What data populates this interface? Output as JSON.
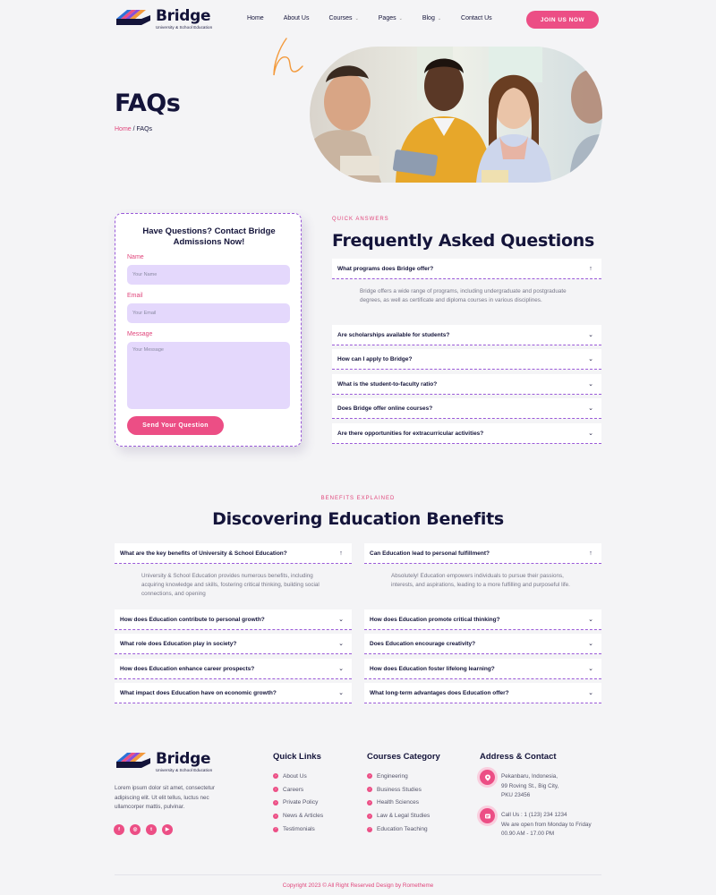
{
  "brand": {
    "name": "Bridge",
    "tagline": "University & School Education",
    "colors": {
      "accent": "#ec4e85",
      "navy": "#14143a",
      "lavender": "#e4d8fc",
      "border": "#9a5ad8"
    }
  },
  "nav": {
    "items": [
      {
        "label": "Home",
        "has_dropdown": false
      },
      {
        "label": "About Us",
        "has_dropdown": false
      },
      {
        "label": "Courses",
        "has_dropdown": true
      },
      {
        "label": "Pages",
        "has_dropdown": true
      },
      {
        "label": "Blog",
        "has_dropdown": true
      },
      {
        "label": "Contact Us",
        "has_dropdown": false
      }
    ],
    "cta": "JOIN US NOW"
  },
  "hero": {
    "title": "FAQs",
    "breadcrumb": {
      "home": "Home",
      "separator": " / ",
      "current": "FAQs"
    }
  },
  "contact_form": {
    "title": "Have Questions? Contact Bridge Admissions Now!",
    "name_label": "Name",
    "name_placeholder": "Your Name",
    "email_label": "Email",
    "email_placeholder": "Your Email",
    "message_label": "Message",
    "message_placeholder": "Your Message",
    "submit": "Send Your Question"
  },
  "faq": {
    "eyebrow": "QUICK ANSWERS",
    "title": "Frequently Asked Questions",
    "open": {
      "question": "What programs does Bridge offer?",
      "answer": "Bridge offers a wide range of programs, including undergraduate and postgraduate degrees, as well as certificate and diploma courses in various disciplines."
    },
    "items": [
      "Are scholarships available for students?",
      "How can I apply to Bridge?",
      "What is the student-to-faculty ratio?",
      "Does Bridge offer online courses?",
      "Are there opportunities for extracurricular activities?"
    ]
  },
  "benefits": {
    "eyebrow": "BENEFITS EXPLAINED",
    "title": "Discovering Education Benefits",
    "left_open": {
      "question": "What are the key benefits of University & School Education?",
      "answer": "University & School Education provides numerous benefits, including acquiring knowledge and skills, fostering critical thinking, building social connections, and opening"
    },
    "left_items": [
      "How does Education contribute to personal growth?",
      "What role does Education play in society?",
      "How does Education enhance career prospects?",
      "What impact does Education have on economic growth?"
    ],
    "right_open": {
      "question": "Can Education lead to personal fulfillment?",
      "answer": "Absolutely! Education empowers individuals to pursue their passions, interests, and aspirations, leading to a more fulfilling and purposeful life."
    },
    "right_items": [
      "How does Education promote critical thinking?",
      "Does Education encourage creativity?",
      "How does Education foster lifelong learning?",
      "What long-term advantages does Education offer?"
    ]
  },
  "footer": {
    "description": "Lorem ipsum dolor sit amet, consectetur adipiscing elit. Ut elit tellus, luctus nec ullamcorper mattis, pulvinar.",
    "socials": [
      {
        "icon": "facebook-icon",
        "glyph": "f"
      },
      {
        "icon": "instagram-icon",
        "glyph": "◎"
      },
      {
        "icon": "twitter-icon",
        "glyph": "t"
      },
      {
        "icon": "youtube-icon",
        "glyph": "▶"
      }
    ],
    "quick_links": {
      "heading": "Quick Links",
      "items": [
        "About Us",
        "Careers",
        "Private Policy",
        "News & Articles",
        "Testimonials"
      ]
    },
    "courses": {
      "heading": "Courses Category",
      "items": [
        "Engineering",
        "Business Studies",
        "Health Sciences",
        "Law & Legal Studies",
        "Education Teaching"
      ]
    },
    "contact": {
      "heading": "Address & Contact",
      "address": [
        "Pekanbaru, Indonesia,",
        "99 Roving St., Big City,",
        "PKU 23456"
      ],
      "phone": [
        "Call Us : 1 (123) 234 1234",
        "We are open from Monday to Friday",
        "00.90 AM - 17.00 PM"
      ]
    },
    "copyright": "Copyright 2023 © All Right Reserved Design by Rometheme"
  }
}
